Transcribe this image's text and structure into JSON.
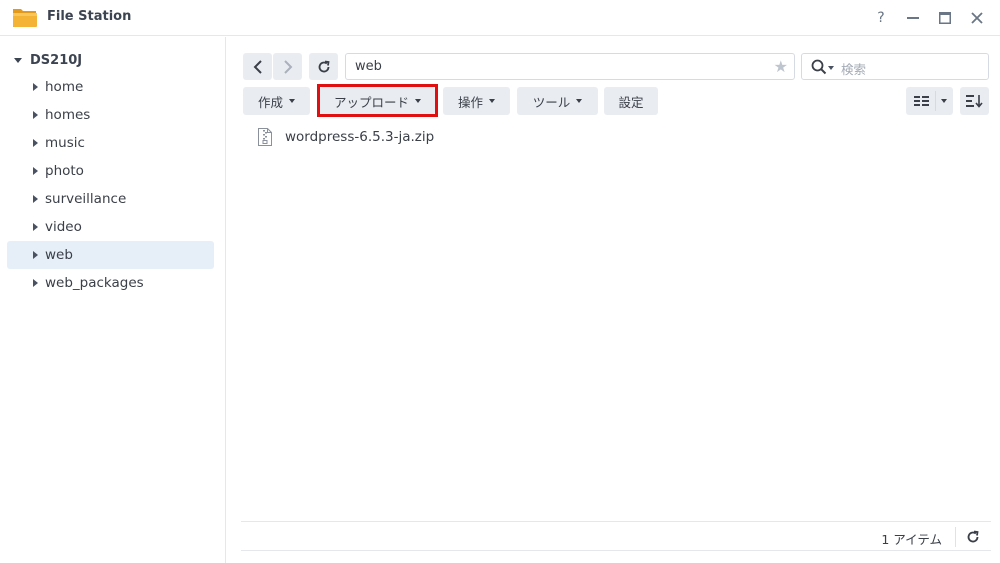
{
  "window": {
    "title": "File Station",
    "icon": "folder-icon",
    "controls": [
      "help-icon",
      "minimize-icon",
      "maximize-icon",
      "close-icon"
    ],
    "help_label": "?"
  },
  "sidebar": {
    "root": "DS210J",
    "items": [
      {
        "label": "home",
        "selected": false
      },
      {
        "label": "homes",
        "selected": false
      },
      {
        "label": "music",
        "selected": false
      },
      {
        "label": "photo",
        "selected": false
      },
      {
        "label": "surveillance",
        "selected": false
      },
      {
        "label": "video",
        "selected": false
      },
      {
        "label": "web",
        "selected": true
      },
      {
        "label": "web_packages",
        "selected": false
      }
    ]
  },
  "navigation": {
    "back_icon": "chevron-left-icon",
    "forward_icon": "chevron-right-icon",
    "refresh_icon": "refresh-icon",
    "path": "web",
    "favorite_icon": "star-icon"
  },
  "search": {
    "placeholder": "検索",
    "icon": "search-icon"
  },
  "toolbar": {
    "create_label": "作成",
    "upload_label": "アップロード",
    "action_label": "操作",
    "tools_label": "ツール",
    "settings_label": "設定",
    "highlighted_button": "upload",
    "highlight_color": "#e01010"
  },
  "files": [
    {
      "name": "wordpress-6.5.3-ja.zip",
      "icon": "zip-file-icon"
    }
  ],
  "status": {
    "item_count": "1 アイテム"
  },
  "colors": {
    "selected_bg": "#e6eef8",
    "button_bg": "#e9ecf1",
    "folder": "#f5b335"
  }
}
